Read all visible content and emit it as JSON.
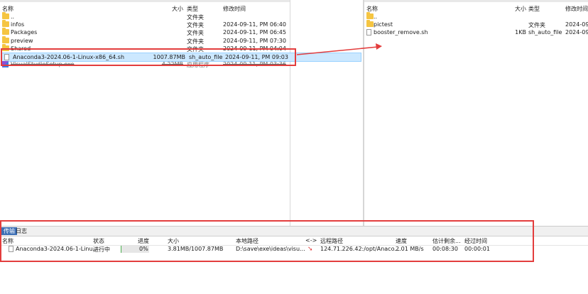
{
  "columns": {
    "name": "名称",
    "size": "大小",
    "type": "类型",
    "modified": "修改时间"
  },
  "left_files": [
    {
      "name": "..",
      "size": "",
      "type": "文件夹",
      "modified": "",
      "icon": "folder-icon"
    },
    {
      "name": "infos",
      "size": "",
      "type": "文件夹",
      "modified": "2024-09-11, PM 06:40",
      "icon": "folder-icon"
    },
    {
      "name": "Packages",
      "size": "",
      "type": "文件夹",
      "modified": "2024-09-11, PM 06:45",
      "icon": "folder-icon"
    },
    {
      "name": "preview",
      "size": "",
      "type": "文件夹",
      "modified": "2024-09-11, PM 07:30",
      "icon": "folder-icon"
    },
    {
      "name": "Shared",
      "size": "",
      "type": "文件夹",
      "modified": "2024-09-11, PM 04:04",
      "icon": "folder-icon"
    },
    {
      "name": "Anaconda3-2024.06-1-Linux-x86_64.sh",
      "size": "1007.87MB",
      "type": "sh_auto_file",
      "modified": "2024-09-11, PM 09:03",
      "icon": "file-icon",
      "selected": true
    },
    {
      "name": "VisualStudioSetup.exe",
      "size": "4.22MB",
      "type": "应用程序",
      "modified": "2024-09-11, PM 03:36",
      "icon": "exe-icon"
    }
  ],
  "right_files": [
    {
      "name": "..",
      "size": "",
      "type": "",
      "modified": "",
      "icon": "folder-icon"
    },
    {
      "name": "pictest",
      "size": "",
      "type": "文件夹",
      "modified": "2024-09-",
      "icon": "folder-icon"
    },
    {
      "name": "booster_remove.sh",
      "size": "1KB",
      "type": "sh_auto_file",
      "modified": "2024-09-",
      "icon": "file-icon"
    }
  ],
  "bottom": {
    "tabs": [
      {
        "label": "传输",
        "active": true
      },
      {
        "label": "日志",
        "active": false
      }
    ],
    "queue_columns": {
      "name": "名称",
      "status": "状态",
      "progress": "进度",
      "size": "大小",
      "local": "本地路径",
      "direction": "<->",
      "remote": "远程路径",
      "speed": "速度",
      "eta": "估计剩余...",
      "elapsed": "经过时间"
    },
    "transfer": {
      "name": "Anaconda3-2024.06-1-Linu...",
      "status": "进行中",
      "progress_text": "0%",
      "progress_fraction": 0.004,
      "size": "3.81MB/1007.87MB",
      "local": "D:\\save\\exe\\ideas\\visu...",
      "remote": "124.71.226.42:/opt/Anaco...",
      "speed": "2.01 MB/s",
      "eta": "00:08:30",
      "elapsed": "00:00:01"
    }
  },
  "colors": {
    "annotation": "#e33d3d",
    "selection": "#cce8ff",
    "tab_active": "#3d6fb5"
  }
}
